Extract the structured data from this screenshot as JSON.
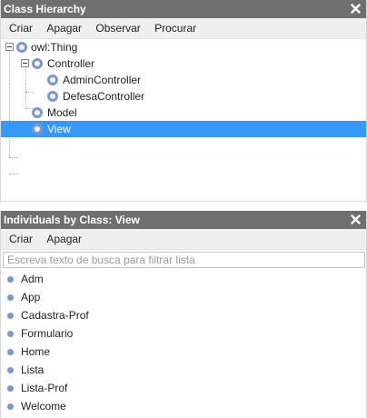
{
  "hierarchy_panel": {
    "title": "Class Hierarchy",
    "menu": [
      "Criar",
      "Apagar",
      "Observar",
      "Procurar"
    ],
    "tree": [
      {
        "label": "owl:Thing",
        "expanded": true,
        "selected": false
      },
      {
        "label": "Controller",
        "expanded": true,
        "selected": false
      },
      {
        "label": "AdminController",
        "selected": false
      },
      {
        "label": "DefesaController",
        "selected": false
      },
      {
        "label": "Model",
        "selected": false
      },
      {
        "label": "View",
        "selected": true
      }
    ]
  },
  "individuals_panel": {
    "title": "Individuals by Class: View",
    "menu": [
      "Criar",
      "Apagar"
    ],
    "search_placeholder": "Escreva texto de busca para filtrar lista",
    "items": [
      "Adm",
      "App",
      "Cadastra-Prof",
      "Formulario",
      "Home",
      "Lista",
      "Lista-Prof",
      "Welcome"
    ]
  },
  "colors": {
    "titlebar": "#6f6f6f",
    "selection": "#3399ff",
    "class_icon": "#7d99c7"
  },
  "icons": {
    "close": "close-icon",
    "class": "class-circle-icon",
    "individual": "individual-dot-icon",
    "collapse": "collapse-toggle-icon"
  }
}
